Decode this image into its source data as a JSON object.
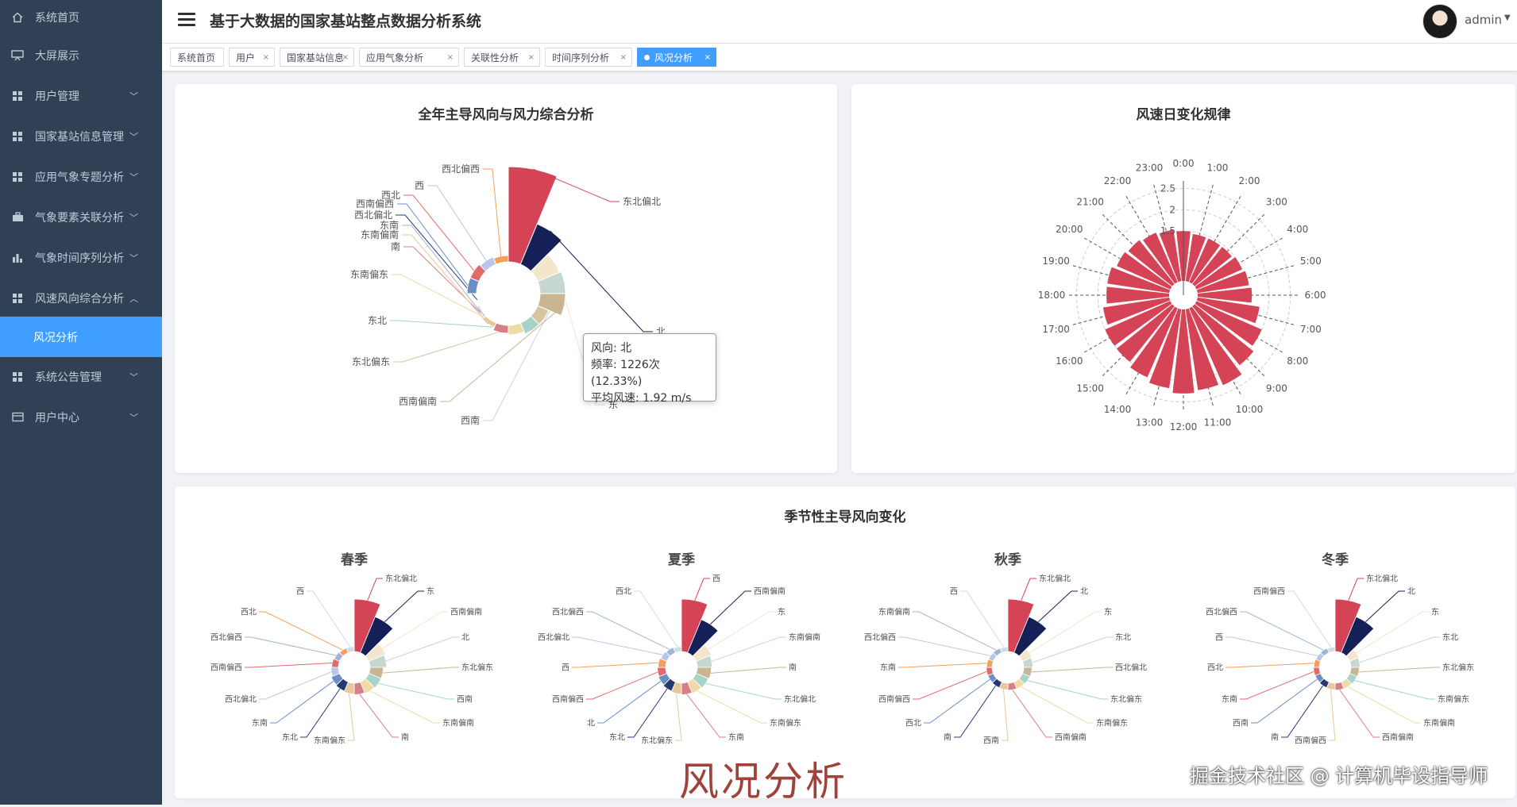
{
  "app_title": "基于大数据的国家基站整点数据分析系统",
  "user": {
    "name": "admin"
  },
  "sidebar": {
    "items": [
      {
        "label": "系统首页",
        "icon": "home-icon",
        "chevron": false
      },
      {
        "label": "大屏展示",
        "icon": "display-icon",
        "chevron": false
      },
      {
        "label": "用户管理",
        "icon": "grid-icon",
        "chevron": true
      },
      {
        "label": "国家基站信息管理",
        "icon": "grid-icon",
        "chevron": true
      },
      {
        "label": "应用气象专题分析",
        "icon": "grid-icon",
        "chevron": true
      },
      {
        "label": "气象要素关联分析",
        "icon": "briefcase-icon",
        "chevron": true
      },
      {
        "label": "气象时间序列分析",
        "icon": "bar-chart-icon",
        "chevron": true
      },
      {
        "label": "风速风向综合分析",
        "icon": "grid-icon",
        "chevron": true,
        "expanded": true
      },
      {
        "label": "风况分析",
        "icon": "",
        "chevron": false,
        "selected": true
      },
      {
        "label": "系统公告管理",
        "icon": "grid-icon",
        "chevron": true
      },
      {
        "label": "用户中心",
        "icon": "card-icon",
        "chevron": true
      }
    ]
  },
  "tabs": [
    {
      "label": "系统首页",
      "closable": false
    },
    {
      "label": "用户",
      "closable": true
    },
    {
      "label": "国家基站信息",
      "closable": true
    },
    {
      "label": "应用气象分析",
      "closable": true
    },
    {
      "label": "关联性分析",
      "closable": true
    },
    {
      "label": "时间序列分析",
      "closable": true
    },
    {
      "label": "风况分析",
      "closable": true,
      "active": true
    }
  ],
  "tooltip": {
    "line1": "风向: 北",
    "line2": "频率: 1226次 (12.33%)",
    "line3": "平均风速: 1.92 m/s"
  },
  "watermark": {
    "main": "风况分析",
    "credit": "掘金技术社区 @ 计算机毕设指导师"
  },
  "colors": {
    "accent": "#409eff",
    "sidebar": "#304156",
    "red": "#d44456",
    "navy": "#142057"
  },
  "chart_data": [
    {
      "type": "pie",
      "title": "全年主导风向与风力综合分析",
      "subtype": "nightingale-rose",
      "slices": [
        {
          "label": "东北偏北",
          "value": 3.0,
          "color": "#d44456"
        },
        {
          "label": "北",
          "value": 1.92,
          "color": "#142057"
        },
        {
          "label": "东",
          "value": 0.5,
          "color": "#f3e6cb"
        },
        {
          "label": "西南",
          "value": 0.42,
          "color": "#c6d7d2"
        },
        {
          "label": "西南偏南",
          "value": 0.38,
          "color": "#c9b591"
        },
        {
          "label": "东北偏东",
          "value": 0.3,
          "color": "#d5c6a1"
        },
        {
          "label": "东北",
          "value": 0.28,
          "color": "#a7d3c9"
        },
        {
          "label": "东南偏东",
          "value": 0.27,
          "color": "#f0dba5"
        },
        {
          "label": "南",
          "value": 0.26,
          "color": "#d67f89"
        },
        {
          "label": "东南偏南",
          "value": 0.25,
          "color": "#e8c89b"
        },
        {
          "label": "东南",
          "value": 0.24,
          "color": "#9fb5d6"
        },
        {
          "label": "西北偏北",
          "value": 0.22,
          "color": "#26396e"
        },
        {
          "label": "西南偏西",
          "value": 0.18,
          "color": "#6a8fc7"
        },
        {
          "label": "西北",
          "value": 0.15,
          "color": "#e26a6a"
        },
        {
          "label": "西",
          "value": 0.14,
          "color": "#b8c7e8"
        },
        {
          "label": "西北偏西",
          "value": 0.13,
          "color": "#f1a05b"
        }
      ]
    },
    {
      "type": "bar",
      "subtype": "polar",
      "title": "风速日变化规律",
      "categories": [
        "0:00",
        "1:00",
        "2:00",
        "3:00",
        "4:00",
        "5:00",
        "6:00",
        "7:00",
        "8:00",
        "9:00",
        "10:00",
        "11:00",
        "12:00",
        "13:00",
        "14:00",
        "15:00",
        "16:00",
        "17:00",
        "18:00",
        "19:00",
        "20:00",
        "21:00",
        "22:00",
        "23:00"
      ],
      "values": [
        1.5,
        1.45,
        1.45,
        1.45,
        1.5,
        1.55,
        1.6,
        1.8,
        2.0,
        2.1,
        2.3,
        2.25,
        2.3,
        2.2,
        2.1,
        2.0,
        2.0,
        1.9,
        1.8,
        1.8,
        1.7,
        1.65,
        1.6,
        1.55
      ],
      "radial_ticks": [
        1.5,
        2,
        2.5
      ],
      "color": "#d44456"
    },
    {
      "type": "pie",
      "subtype": "nightingale-rose",
      "title": "季节性主导风向变化",
      "charts": [
        {
          "season": "春季",
          "slices": [
            {
              "label": "东北偏北",
              "value": 3.5,
              "color": "#d44456"
            },
            {
              "label": "东",
              "value": 2.6,
              "color": "#142057"
            },
            {
              "label": "西南偏南",
              "value": 2.2,
              "color": "#f3e6cb"
            },
            {
              "label": "北",
              "value": 2.0,
              "color": "#c6d7d2"
            },
            {
              "label": "东北偏东",
              "value": 1.6,
              "color": "#c9b591"
            },
            {
              "label": "西南",
              "value": 1.6,
              "color": "#a7d3c9"
            },
            {
              "label": "东南偏南",
              "value": 1.5,
              "color": "#f0dba5"
            },
            {
              "label": "南",
              "value": 1.4,
              "color": "#d67f89"
            },
            {
              "label": "东南偏东",
              "value": 1.3,
              "color": "#e8c89b"
            },
            {
              "label": "东北",
              "value": 1.2,
              "color": "#26396e"
            },
            {
              "label": "东南",
              "value": 1.1,
              "color": "#6a8fc7"
            },
            {
              "label": "西北偏北",
              "value": 0.9,
              "color": "#b8c7e8"
            },
            {
              "label": "西南偏西",
              "value": 0.8,
              "color": "#e26a6a"
            },
            {
              "label": "西北偏西",
              "value": 0.7,
              "color": "#9fb5d6"
            },
            {
              "label": "西北",
              "value": 0.6,
              "color": "#f1a05b"
            },
            {
              "label": "西",
              "value": 0.6,
              "color": "#cfdbe9"
            }
          ]
        },
        {
          "season": "夏季",
          "slices": [
            {
              "label": "西",
              "value": 3.5,
              "color": "#d44456"
            },
            {
              "label": "西南偏南",
              "value": 2.4,
              "color": "#142057"
            },
            {
              "label": "东",
              "value": 2.0,
              "color": "#f3e6cb"
            },
            {
              "label": "东南偏南",
              "value": 1.8,
              "color": "#c6d7d2"
            },
            {
              "label": "南",
              "value": 1.7,
              "color": "#c9b591"
            },
            {
              "label": "东北偏北",
              "value": 1.6,
              "color": "#a7d3c9"
            },
            {
              "label": "东南偏东",
              "value": 1.5,
              "color": "#f0dba5"
            },
            {
              "label": "东南",
              "value": 1.4,
              "color": "#d67f89"
            },
            {
              "label": "东北偏东",
              "value": 1.3,
              "color": "#e8c89b"
            },
            {
              "label": "东北",
              "value": 1.2,
              "color": "#26396e"
            },
            {
              "label": "北",
              "value": 1.1,
              "color": "#6a8fc7"
            },
            {
              "label": "西南偏西",
              "value": 1.0,
              "color": "#e26a6a"
            },
            {
              "label": "西",
              "value": 0.9,
              "color": "#f1a05b"
            },
            {
              "label": "西北偏北",
              "value": 0.8,
              "color": "#b8c7e8"
            },
            {
              "label": "西北偏西",
              "value": 0.7,
              "color": "#9fb5d6"
            },
            {
              "label": "西北",
              "value": 0.6,
              "color": "#cfdbe9"
            }
          ]
        },
        {
          "season": "秋季",
          "slices": [
            {
              "label": "东北偏北",
              "value": 3.5,
              "color": "#d44456"
            },
            {
              "label": "北",
              "value": 2.6,
              "color": "#142057"
            },
            {
              "label": "东",
              "value": 1.2,
              "color": "#f3e6cb"
            },
            {
              "label": "东北",
              "value": 1.1,
              "color": "#c6d7d2"
            },
            {
              "label": "西北偏北",
              "value": 1.0,
              "color": "#c9b591"
            },
            {
              "label": "东北偏东",
              "value": 0.95,
              "color": "#a7d3c9"
            },
            {
              "label": "东南偏东",
              "value": 0.9,
              "color": "#f0dba5"
            },
            {
              "label": "西南偏南",
              "value": 0.85,
              "color": "#d67f89"
            },
            {
              "label": "西南",
              "value": 0.8,
              "color": "#e8c89b"
            },
            {
              "label": "南",
              "value": 0.75,
              "color": "#26396e"
            },
            {
              "label": "西北",
              "value": 0.7,
              "color": "#6a8fc7"
            },
            {
              "label": "西南偏西",
              "value": 0.7,
              "color": "#e26a6a"
            },
            {
              "label": "东南",
              "value": 0.65,
              "color": "#f1a05b"
            },
            {
              "label": "西北偏西",
              "value": 0.6,
              "color": "#b8c7e8"
            },
            {
              "label": "东南偏南",
              "value": 0.6,
              "color": "#9fb5d6"
            },
            {
              "label": "西",
              "value": 0.55,
              "color": "#cfdbe9"
            }
          ]
        },
        {
          "season": "冬季",
          "slices": [
            {
              "label": "东北偏北",
              "value": 3.5,
              "color": "#d44456"
            },
            {
              "label": "北",
              "value": 2.6,
              "color": "#142057"
            },
            {
              "label": "东",
              "value": 1.2,
              "color": "#f3e6cb"
            },
            {
              "label": "东北",
              "value": 1.1,
              "color": "#c6d7d2"
            },
            {
              "label": "东北偏东",
              "value": 1.0,
              "color": "#c9b591"
            },
            {
              "label": "东南偏东",
              "value": 0.95,
              "color": "#a7d3c9"
            },
            {
              "label": "东南偏南",
              "value": 0.9,
              "color": "#f0dba5"
            },
            {
              "label": "西南偏南",
              "value": 0.85,
              "color": "#d67f89"
            },
            {
              "label": "西南偏西",
              "value": 0.8,
              "color": "#e8c89b"
            },
            {
              "label": "南",
              "value": 0.75,
              "color": "#26396e"
            },
            {
              "label": "西南",
              "value": 0.7,
              "color": "#6a8fc7"
            },
            {
              "label": "东南",
              "value": 0.7,
              "color": "#e26a6a"
            },
            {
              "label": "西北",
              "value": 0.65,
              "color": "#f1a05b"
            },
            {
              "label": "西",
              "value": 0.6,
              "color": "#b8c7e8"
            },
            {
              "label": "西北偏西",
              "value": 0.6,
              "color": "#9fb5d6"
            },
            {
              "label": "西南偏西",
              "value": 0.55,
              "color": "#cfdbe9"
            }
          ]
        }
      ]
    }
  ]
}
